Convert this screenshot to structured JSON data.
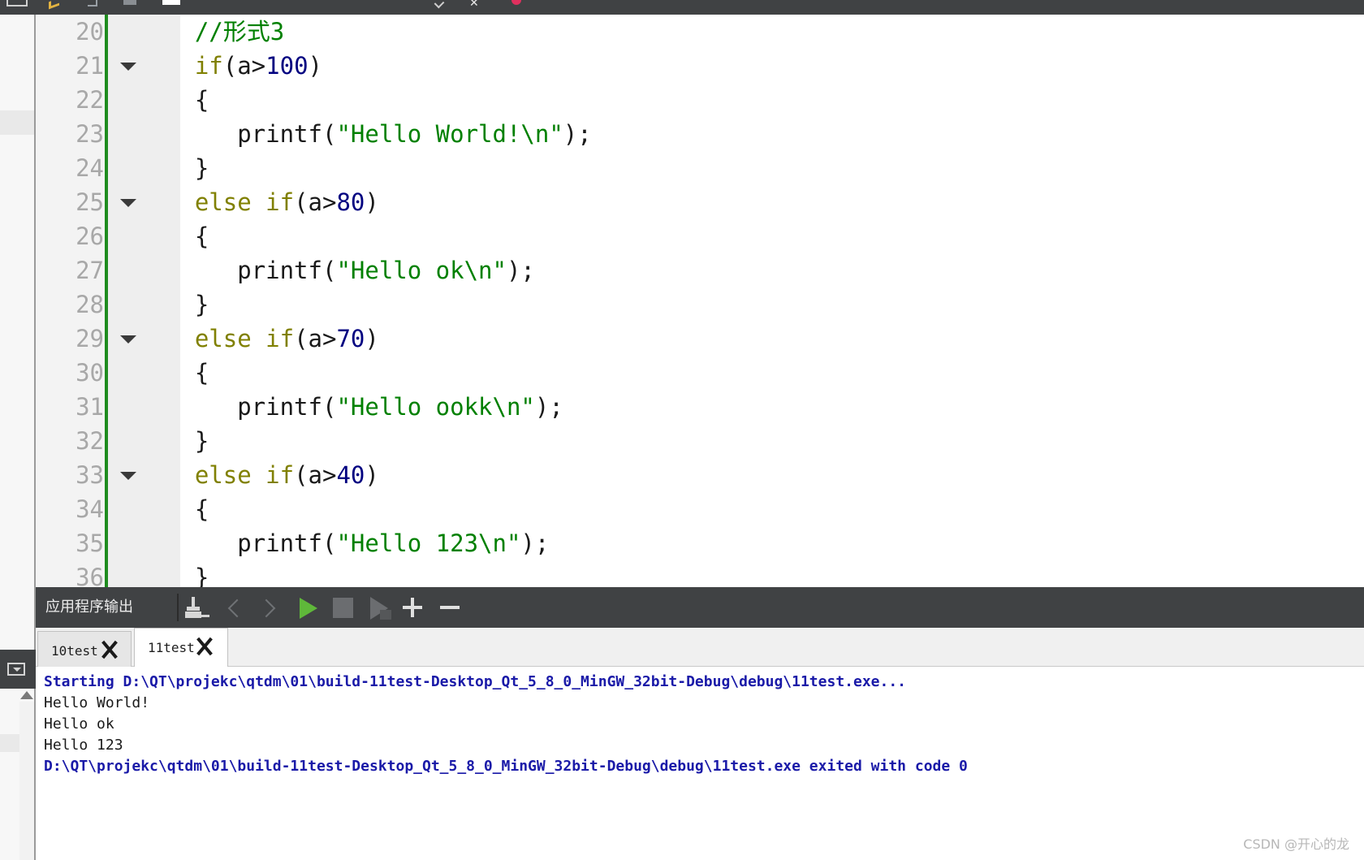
{
  "editor": {
    "lines": [
      {
        "n": "20",
        "fold": false,
        "parts": [
          {
            "t": "    ",
            "c": ""
          },
          {
            "t": "//形式3",
            "c": "cmt"
          }
        ]
      },
      {
        "n": "21",
        "fold": true,
        "parts": [
          {
            "t": "    ",
            "c": ""
          },
          {
            "t": "if",
            "c": "kw"
          },
          {
            "t": "(a>",
            "c": ""
          },
          {
            "t": "100",
            "c": "num"
          },
          {
            "t": ")",
            "c": ""
          }
        ]
      },
      {
        "n": "22",
        "fold": false,
        "parts": [
          {
            "t": "    {",
            "c": ""
          }
        ]
      },
      {
        "n": "23",
        "fold": false,
        "parts": [
          {
            "t": "       printf(",
            "c": ""
          },
          {
            "t": "\"Hello World!\\n\"",
            "c": "str"
          },
          {
            "t": ");",
            "c": ""
          }
        ]
      },
      {
        "n": "24",
        "fold": false,
        "parts": [
          {
            "t": "    }",
            "c": ""
          }
        ]
      },
      {
        "n": "25",
        "fold": true,
        "parts": [
          {
            "t": "    ",
            "c": ""
          },
          {
            "t": "else",
            "c": "kw"
          },
          {
            "t": " ",
            "c": ""
          },
          {
            "t": "if",
            "c": "kw"
          },
          {
            "t": "(a>",
            "c": ""
          },
          {
            "t": "80",
            "c": "num"
          },
          {
            "t": ")",
            "c": ""
          }
        ]
      },
      {
        "n": "26",
        "fold": false,
        "parts": [
          {
            "t": "    {",
            "c": ""
          }
        ]
      },
      {
        "n": "27",
        "fold": false,
        "parts": [
          {
            "t": "       printf(",
            "c": ""
          },
          {
            "t": "\"Hello ok\\n\"",
            "c": "str"
          },
          {
            "t": ");",
            "c": ""
          }
        ]
      },
      {
        "n": "28",
        "fold": false,
        "parts": [
          {
            "t": "    }",
            "c": ""
          }
        ]
      },
      {
        "n": "29",
        "fold": true,
        "parts": [
          {
            "t": "    ",
            "c": ""
          },
          {
            "t": "else",
            "c": "kw"
          },
          {
            "t": " ",
            "c": ""
          },
          {
            "t": "if",
            "c": "kw"
          },
          {
            "t": "(a>",
            "c": ""
          },
          {
            "t": "70",
            "c": "num"
          },
          {
            "t": ")",
            "c": ""
          }
        ]
      },
      {
        "n": "30",
        "fold": false,
        "parts": [
          {
            "t": "    {",
            "c": ""
          }
        ]
      },
      {
        "n": "31",
        "fold": false,
        "parts": [
          {
            "t": "       printf(",
            "c": ""
          },
          {
            "t": "\"Hello ookk\\n\"",
            "c": "str"
          },
          {
            "t": ");",
            "c": ""
          }
        ]
      },
      {
        "n": "32",
        "fold": false,
        "parts": [
          {
            "t": "    }",
            "c": ""
          }
        ]
      },
      {
        "n": "33",
        "fold": true,
        "parts": [
          {
            "t": "    ",
            "c": ""
          },
          {
            "t": "else",
            "c": "kw"
          },
          {
            "t": " ",
            "c": ""
          },
          {
            "t": "if",
            "c": "kw"
          },
          {
            "t": "(a>",
            "c": ""
          },
          {
            "t": "40",
            "c": "num"
          },
          {
            "t": ")",
            "c": ""
          }
        ]
      },
      {
        "n": "34",
        "fold": false,
        "parts": [
          {
            "t": "    {",
            "c": ""
          }
        ]
      },
      {
        "n": "35",
        "fold": false,
        "parts": [
          {
            "t": "       printf(",
            "c": ""
          },
          {
            "t": "\"Hello 123\\n\"",
            "c": "str"
          },
          {
            "t": ");",
            "c": ""
          }
        ]
      },
      {
        "n": "36",
        "fold": false,
        "parts": [
          {
            "t": "    }",
            "c": ""
          }
        ]
      }
    ]
  },
  "output_pane": {
    "title": "应用程序输出",
    "toolbar_icons": [
      "clear-icon",
      "prev-icon",
      "next-icon",
      "run-icon",
      "stop-icon",
      "attach-icon",
      "zoom-in-icon",
      "zoom-out-icon"
    ],
    "tabs": [
      {
        "label": "10test",
        "active": false
      },
      {
        "label": "11test",
        "active": true
      }
    ],
    "lines": [
      {
        "text": "Starting D:\\QT\\projekc\\qtdm\\01\\build-11test-Desktop_Qt_5_8_0_MinGW_32bit-Debug\\debug\\11test.exe...",
        "kind": "sys"
      },
      {
        "text": "Hello World!",
        "kind": "std"
      },
      {
        "text": "Hello ok",
        "kind": "std"
      },
      {
        "text": "Hello 123",
        "kind": "std"
      },
      {
        "text": "D:\\QT\\projekc\\qtdm\\01\\build-11test-Desktop_Qt_5_8_0_MinGW_32bit-Debug\\debug\\11test.exe exited with code 0",
        "kind": "sys"
      }
    ]
  },
  "colors": {
    "toolbar_bg": "#404244",
    "keyword": "#808000",
    "number": "#000080",
    "string": "#008000",
    "system_output": "#1a1aa8",
    "gutter_marker": "#1f8c1f",
    "run_green": "#5fb83a"
  },
  "watermark": "CSDN @开心的龙"
}
